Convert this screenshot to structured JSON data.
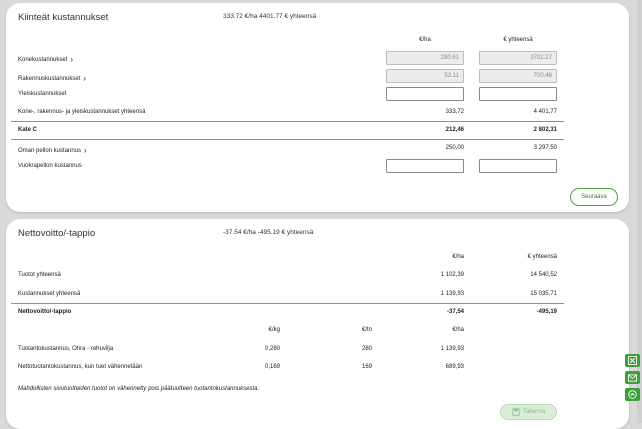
{
  "fixed_costs": {
    "title": "Kiinteät kustannukset",
    "summary": "333.72 €/ha 4401.77 € yhteensä",
    "col_ha": "€/ha",
    "col_total": "€ yhteensä",
    "rows": [
      {
        "label": "Konekustannukset",
        "ha": "280.61",
        "total": "3701.27"
      },
      {
        "label": "Rakennuskustannukset",
        "ha": "53.11",
        "total": "700.46"
      },
      {
        "label": "Yleiskustannukset",
        "ha": "",
        "total": ""
      },
      {
        "label": "Kone-, rakennus- ja yleiskustannukset yhteensä",
        "ha": "333,72",
        "total": "4 401,77"
      },
      {
        "label": "Kate C",
        "ha": "212,46",
        "total": "2 802,31"
      },
      {
        "label": "Oman pellon kustannus",
        "ha": "250,00",
        "total": "3 297,50"
      },
      {
        "label": "Vuokrapellon kustannus",
        "ha": "",
        "total": ""
      }
    ],
    "next_button": "Seuraava"
  },
  "net_profit": {
    "title": "Nettovoitto/-tappio",
    "summary": "-37.54 €/ha -495.19 € yhteensä",
    "col_ha": "€/ha",
    "col_total": "€ yhteensä",
    "rows": [
      {
        "label": "Tuotot yhteensä",
        "ha": "1 102,39",
        "total": "14 540,52"
      },
      {
        "label": "Kustannukset yhteensä",
        "ha": "1 139,93",
        "total": "15 035,71"
      },
      {
        "label": "Nettovoitto/-tappio",
        "ha": "-37,54",
        "total": "-495,19"
      }
    ],
    "unit_cols": {
      "kg": "€/kg",
      "tn": "€/tn",
      "ha": "€/ha"
    },
    "unit_rows": [
      {
        "label": "Tuotantokustannus, Ohra - rehuvilja",
        "kg": "0,280",
        "tn": "280",
        "ha": "1 139,93"
      },
      {
        "label": "Nettotuotantokustannus, kun tuet vähennetään",
        "kg": "0,169",
        "tn": "169",
        "ha": "689,93"
      }
    ],
    "note": "Mahdollisten sivutuotteiden tuotot on vähennetty pois päätuotteen tuotantokustannuksesta.",
    "save_button": "Tallenna"
  },
  "side_icons": [
    "excel-icon",
    "mail-icon",
    "scroll-up-icon"
  ],
  "colors": {
    "accent": "#3e9f3a",
    "line": "#6ab04c"
  }
}
